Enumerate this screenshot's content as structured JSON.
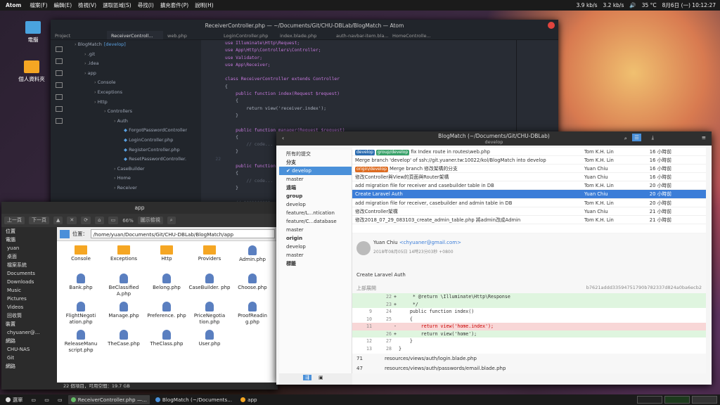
{
  "topbar": {
    "app": "Atom",
    "menus": [
      "檔案(F)",
      "編輯(E)",
      "檢視(V)",
      "選取區域(S)",
      "尋找(I)",
      "擴充套件(P)",
      "說明(H)"
    ],
    "net_down": "3.9 kb/s",
    "net_up": "3.2 kb/s",
    "temp": "35 °C",
    "datetime": "8月6日 (一) 10:12:27"
  },
  "desktop": [
    {
      "label": "電腦"
    },
    {
      "label": "個人資料夾"
    }
  ],
  "atom": {
    "title": "ReceiverController.php — ~/Documents/Git/CHU-DBLab/BlogMatch — Atom",
    "tabs": [
      "Project",
      "ReceiverControll...",
      "web.php",
      "LoginController.php",
      "index.blade.php",
      "auth-navbar-item.bla...",
      "HomeControlle..."
    ],
    "tree": [
      {
        "t": "BlogMatch",
        "b": "[develop]",
        "d": 0
      },
      {
        "t": ".git",
        "d": 1
      },
      {
        "t": ".idea",
        "d": 1
      },
      {
        "t": "app",
        "d": 1
      },
      {
        "t": "Console",
        "d": 2
      },
      {
        "t": "Exceptions",
        "d": 2
      },
      {
        "t": "Http",
        "d": 2
      },
      {
        "t": "Controllers",
        "d": 3
      },
      {
        "t": "Auth",
        "d": 4
      },
      {
        "t": "ForgotPasswordController",
        "d": 5
      },
      {
        "t": "LoginController.php",
        "d": 5
      },
      {
        "t": "RegisterController.php",
        "d": 5
      },
      {
        "t": "ResetPasswordController.",
        "d": 5
      },
      {
        "t": "CaseBuilder",
        "d": 4
      },
      {
        "t": "Home",
        "d": 4
      },
      {
        "t": "Receiver",
        "d": 4
      }
    ],
    "line_numbers": [
      "",
      "",
      "",
      "",
      "",
      "",
      "",
      "",
      "",
      "",
      "",
      "",
      "",
      "",
      "",
      "",
      "22",
      "",
      "",
      "",
      "",
      "",
      "",
      ""
    ],
    "code": [
      "use Illuminate\\Http\\Request;",
      "use App\\Http\\Controllers\\Controller;",
      "use Validator;",
      "use App\\Receiver;",
      "",
      "class ReceiverController extends Controller",
      "{",
      "    public function index(Request $request)",
      "    {",
      "        return view('receiver.index');",
      "    }",
      "",
      "    public function manager(Request $request)",
      "    {",
      "        // code...",
      "    }",
      "",
      "    public function",
      "    {",
      "        // code...",
      "    }",
      "",
      "    // **********"
    ]
  },
  "fm": {
    "title": "app",
    "back": "上一頁",
    "forward": "下一頁",
    "zoom": "66%",
    "view": "圖示檢視",
    "location_label": "位置：",
    "path": "/home/yuan/Documents/Git/CHU-DBLab/BlogMatch/app",
    "side": [
      {
        "t": "位置",
        "h": 1
      },
      {
        "t": "電腦",
        "h": 1
      },
      {
        "t": "yuan"
      },
      {
        "t": "桌面"
      },
      {
        "t": "檔案系統"
      },
      {
        "t": "Documents"
      },
      {
        "t": "Downloads"
      },
      {
        "t": "Music"
      },
      {
        "t": "Pictures"
      },
      {
        "t": "Videos"
      },
      {
        "t": "回收筒"
      },
      {
        "t": "裝置",
        "h": 1
      },
      {
        "t": "chyuaner@..."
      },
      {
        "t": "網路",
        "h": 1
      },
      {
        "t": "CHU-NAS"
      },
      {
        "t": "Git"
      },
      {
        "t": "網路",
        "h": 1
      }
    ],
    "items": [
      {
        "n": "Console",
        "k": "d"
      },
      {
        "n": "Exceptions",
        "k": "d"
      },
      {
        "n": "Http",
        "k": "d"
      },
      {
        "n": "Providers",
        "k": "d"
      },
      {
        "n": "Admin.php",
        "k": "f"
      },
      {
        "n": "Bank.php",
        "k": "f"
      },
      {
        "n": "BeClassified A.php",
        "k": "f"
      },
      {
        "n": "Belong.php",
        "k": "f"
      },
      {
        "n": "CaseBuilder. php",
        "k": "f"
      },
      {
        "n": "Choose.php",
        "k": "f"
      },
      {
        "n": "FlightNegoti ation.php",
        "k": "f"
      },
      {
        "n": "Manage.php",
        "k": "f"
      },
      {
        "n": "Preference. php",
        "k": "f"
      },
      {
        "n": "PriceNegotia tion.php",
        "k": "f"
      },
      {
        "n": "ProofReadin g.php",
        "k": "f"
      },
      {
        "n": "ReleaseManu script.php",
        "k": "f"
      },
      {
        "n": "TheCase.php",
        "k": "f"
      },
      {
        "n": "TheClass.php",
        "k": "f"
      },
      {
        "n": "User.php",
        "k": "f"
      }
    ],
    "status": "22 個項目，可用空間：19.7 GB"
  },
  "gk": {
    "title": "BlogMatch (~/Documents/Git/CHU-DBLab)",
    "subtitle": "develop",
    "nav": [
      {
        "t": "所有的提交"
      },
      {
        "t": "分支",
        "hd": 1
      },
      {
        "t": "✔ develop",
        "sel": 1
      },
      {
        "t": "master"
      },
      {
        "t": "遠端",
        "hd": 1
      },
      {
        "t": "group",
        "hd": 1
      },
      {
        "t": "develop"
      },
      {
        "t": "feature/L...ntication"
      },
      {
        "t": "feature/C...database"
      },
      {
        "t": "master"
      },
      {
        "t": "origin",
        "hd": 1
      },
      {
        "t": "develop"
      },
      {
        "t": "master"
      },
      {
        "t": "標籤",
        "hd": 1
      }
    ],
    "commits": [
      {
        "tags": [
          "develop",
          "group/develop"
        ],
        "m": "fix Index route in routes\\web.php",
        "a": "Tom K.H. Lin",
        "t": "16 小時前"
      },
      {
        "m": "Merge branch 'develop' of ssh://git.yuaner.tw:10022/kol/BlogMatch into develop",
        "a": "Tom K.H. Lin",
        "t": "16 小時前"
      },
      {
        "tags": [
          "origin/develop"
        ],
        "m": "Merge branch 修改架構的分支",
        "a": "Yuan Chiu",
        "t": "16 小時前"
      },
      {
        "m": "修改Controller與View的頁面與Router架構",
        "a": "Yuan Chiu",
        "t": "16 小時前"
      },
      {
        "m": "add migration file for receiver and casebuilder table in DB",
        "a": "Tom K.H. Lin",
        "t": "20 小時前"
      },
      {
        "m": "Create Laravel Auth",
        "a": "Yuan Chiu",
        "t": "20 小時前",
        "sel": 1
      },
      {
        "m": "add migration file for receiver, casebuilder and admin table in DB",
        "a": "Tom K.H. Lin",
        "t": "20 小時前"
      },
      {
        "m": "修改Controller架構",
        "a": "Yuan Chiu",
        "t": "21 小時前"
      },
      {
        "m": "修改2018_07_29_083103_create_admin_table.php 將admin改成Admin",
        "a": "Tom K.H. Lin",
        "t": "21 小時前"
      }
    ],
    "author": "Yuan Chiu",
    "email": "<chyuaner@gmail.com>",
    "date": "2018年08月05日 14時23分03秒 +0800",
    "message": "Create Laravel Auth",
    "parent": "上部展開",
    "hash": "b7621addd33594751790b782337d824a0ba6ecb2",
    "diff": [
      {
        "o": "",
        "n": "22",
        "s": "+",
        "c": "     * @return \\Illuminate\\Http\\Response",
        "k": "add"
      },
      {
        "o": "",
        "n": "23",
        "s": "+",
        "c": "     */",
        "k": "add"
      },
      {
        "o": "9",
        "n": "24",
        "s": "",
        "c": "    public function index()",
        "k": ""
      },
      {
        "o": "10",
        "n": "25",
        "s": "",
        "c": "    {",
        "k": ""
      },
      {
        "o": "11",
        "n": "",
        "s": "-",
        "c": "        return view('home.index');",
        "k": "del"
      },
      {
        "o": "",
        "n": "26",
        "s": "+",
        "c": "        return view('home');",
        "k": "add"
      },
      {
        "o": "12",
        "n": "27",
        "s": "",
        "c": "    }",
        "k": ""
      },
      {
        "o": "13",
        "n": "28",
        "s": "",
        "c": "}",
        "k": ""
      }
    ],
    "files": [
      {
        "c": "71",
        "p": "resources/views/auth/login.blade.php"
      },
      {
        "c": "47",
        "p": "resources/views/auth/passwords/email.blade.php"
      }
    ]
  },
  "taskbar": {
    "start": "選單",
    "tasks": [
      "ReceiverController.php —...",
      "BlogMatch (~/Documents...",
      "app"
    ]
  }
}
